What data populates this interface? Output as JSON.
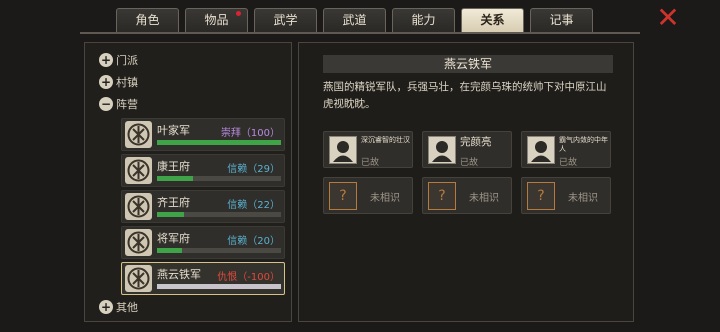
{
  "tabs": [
    {
      "label": "角色",
      "active": false,
      "badge": false
    },
    {
      "label": "物品",
      "active": false,
      "badge": true
    },
    {
      "label": "武学",
      "active": false,
      "badge": false
    },
    {
      "label": "武道",
      "active": false,
      "badge": false
    },
    {
      "label": "能力",
      "active": false,
      "badge": false
    },
    {
      "label": "关系",
      "active": true,
      "badge": false
    },
    {
      "label": "记事",
      "active": false,
      "badge": false
    }
  ],
  "close_icon": "✕",
  "categories": {
    "sect": "门派",
    "town": "村镇",
    "faction": "阵营",
    "other": "其他"
  },
  "factions": [
    {
      "name": "叶家军",
      "relation": "崇拜（100）",
      "rel_color": "#b98be0",
      "bar_color": "#3fa447",
      "level": 1.0,
      "selected": false
    },
    {
      "name": "康王府",
      "relation": "信赖（29）",
      "rel_color": "#5ab1cf",
      "bar_color": "#3fa447",
      "level": 0.29,
      "selected": false
    },
    {
      "name": "齐王府",
      "relation": "信赖（22）",
      "rel_color": "#5ab1cf",
      "bar_color": "#3fa447",
      "level": 0.22,
      "selected": false
    },
    {
      "name": "将军府",
      "relation": "信赖（20）",
      "rel_color": "#5ab1cf",
      "bar_color": "#3fa447",
      "level": 0.2,
      "selected": false
    },
    {
      "name": "燕云铁军",
      "relation": "仇恨（-100）",
      "rel_color": "#e04a3a",
      "bar_color": "#c8c4cc",
      "level": 1.0,
      "selected": true
    }
  ],
  "detail": {
    "title": "燕云铁军",
    "description": "燕国的精锐军队，兵强马壮，在完颜乌珠的统帅下对中原江山虎视眈眈。",
    "members": [
      {
        "name": "深沉睿智的壮汉",
        "status": "已故",
        "known": true,
        "big": false
      },
      {
        "name": "完颜亮",
        "status": "已故",
        "known": true,
        "big": true
      },
      {
        "name": "霸气内敛的中年人",
        "status": "已故",
        "known": true,
        "big": false
      },
      {
        "name": "未相识",
        "status": "",
        "known": false,
        "big": false
      },
      {
        "name": "未相识",
        "status": "",
        "known": false,
        "big": false
      },
      {
        "name": "未相识",
        "status": "",
        "known": false,
        "big": false
      }
    ]
  }
}
